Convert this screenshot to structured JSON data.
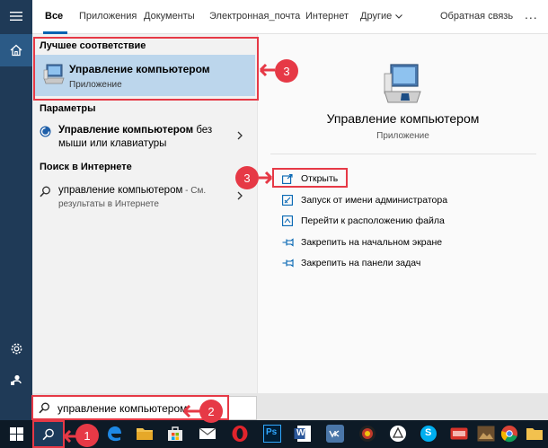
{
  "tabs": {
    "items": [
      "Все",
      "Приложения",
      "Документы",
      "Электронная_почта",
      "Интернет",
      "Другие"
    ],
    "feedback": "Обратная связь",
    "more": "..."
  },
  "results": {
    "best_match_heading": "Лучшее соответствие",
    "best_match": {
      "title": "Управление компьютером",
      "subtitle": "Приложение"
    },
    "settings_heading": "Параметры",
    "settings_item": {
      "bold": "Управление компьютером",
      "rest": " без мыши или клавиатуры"
    },
    "web_heading": "Поиск в Интернете",
    "web_item": {
      "query": "управление компьютером",
      "suffix": " - См. результаты в Интернете"
    }
  },
  "detail": {
    "title": "Управление компьютером",
    "subtitle": "Приложение",
    "actions": [
      {
        "label": "Открыть",
        "icon": "open-icon"
      },
      {
        "label": "Запуск от имени администратора",
        "icon": "admin-shield-icon"
      },
      {
        "label": "Перейти к расположению файла",
        "icon": "file-location-icon"
      },
      {
        "label": "Закрепить на начальном экране",
        "icon": "pin-icon"
      },
      {
        "label": "Закрепить на панели задач",
        "icon": "pin-icon"
      }
    ]
  },
  "search": {
    "value": "управление компьютером"
  },
  "annotations": {
    "badge_1": "1",
    "badge_2": "2",
    "badge_3a": "3",
    "badge_3b": "3"
  },
  "taskbar": {
    "apps": [
      "edge",
      "explorer",
      "store",
      "mail",
      "opera",
      "photoshop",
      "word",
      "vk",
      "antivirus",
      "sketch",
      "skype",
      "ftp",
      "image-viewer",
      "chrome",
      "folder"
    ],
    "labels": {
      "photoshop": "Ps",
      "word": "W",
      "skype": "S"
    }
  },
  "colors": {
    "accent": "#0063b1",
    "rail": "#1f3a57",
    "highlight": "#bcd6ec",
    "annotation": "#e63946",
    "taskbar": "#0d1a26"
  }
}
